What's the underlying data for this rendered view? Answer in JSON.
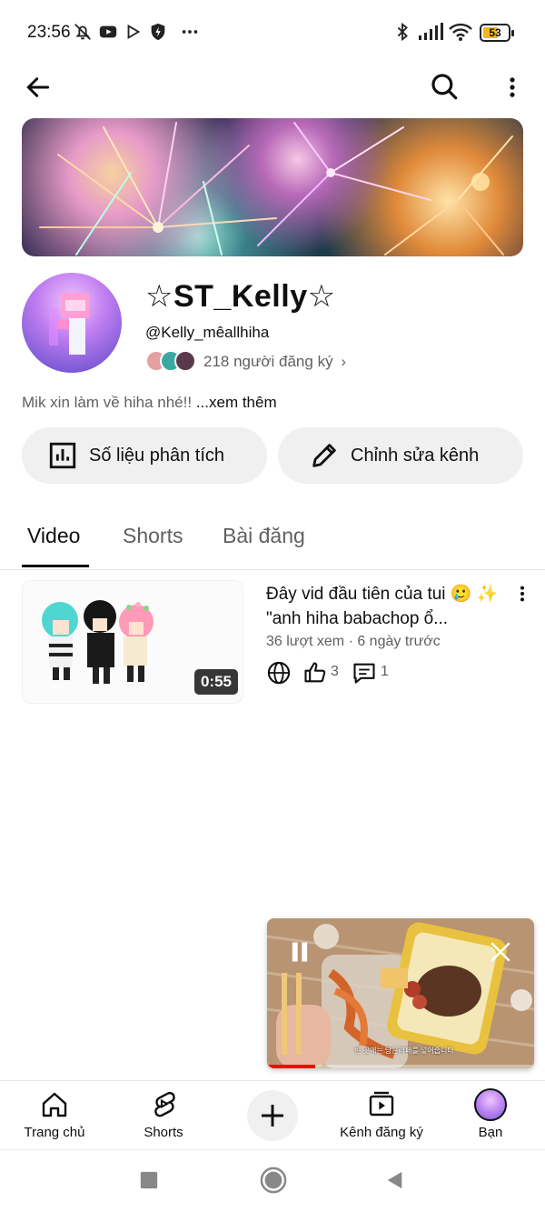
{
  "status_bar": {
    "time": "23:56",
    "battery": "53",
    "icons": [
      "muted-bell-icon",
      "youtube-icon",
      "play-store-icon",
      "vpn-shield-icon",
      "more-dots-icon",
      "bluetooth-icon",
      "signal-icon",
      "wifi-icon",
      "battery-icon"
    ]
  },
  "top_bar": {
    "back_icon": "arrow-left-icon",
    "search_icon": "search-icon",
    "more_icon": "more-vertical-icon"
  },
  "channel": {
    "name": "☆ST_Kelly☆",
    "handle": "@Kelly_mêallhiha",
    "subscribers": "218 người đăng ký",
    "description": "Mik xin làm về hiha nhé!!",
    "more_link": "...xem thêm"
  },
  "actions": {
    "analytics": "Số liệu phân tích",
    "edit": "Chỉnh sửa kênh"
  },
  "tabs": [
    {
      "label": "Video",
      "active": true
    },
    {
      "label": "Shorts",
      "active": false
    },
    {
      "label": "Bài đăng",
      "active": false
    }
  ],
  "video": {
    "title": "Đây vid đầu tiên của tui 🥲 ✨ \"anh hiha babachop ổ...",
    "meta": "36 lượt xem · 6 ngày trước",
    "duration": "0:55",
    "likes": "3",
    "comments": "1"
  },
  "miniplayer": {
    "caption": "빈 곳에는 당근라페를 넣어줍니다",
    "progress": 0.18
  },
  "bottom_nav": [
    {
      "label": "Trang chủ",
      "icon": "home-icon"
    },
    {
      "label": "Shorts",
      "icon": "shorts-icon"
    },
    {
      "label": "",
      "icon": "plus-icon"
    },
    {
      "label": "Kênh đăng ký",
      "icon": "subscriptions-icon"
    },
    {
      "label": "Bạn",
      "icon": "avatar-icon"
    }
  ],
  "colors": {
    "text": "#0f0f0f",
    "secondary": "#606060",
    "chip_bg": "#f0f0f0",
    "accent_red": "#ff0000"
  }
}
